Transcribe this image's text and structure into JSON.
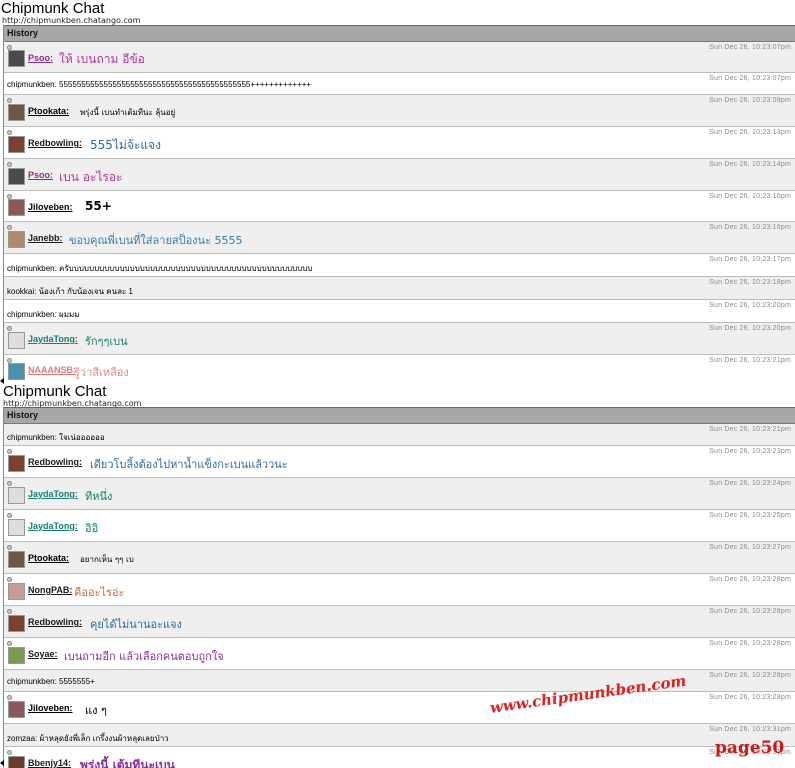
{
  "app": {
    "title": "Chipmunk Chat",
    "url": "http://chipmunkben.chatango.com"
  },
  "history_label": "History",
  "colors": {
    "Psoo": "#8a2c8a",
    "Ptookata": "#000000",
    "Redbowling": "#1a1a1a",
    "Jiloveben": "#000000",
    "Janebb": "#1a1a1a",
    "JaydaTong": "#178070",
    "NAAANSB": "#e07a7a",
    "NongPAB": "#1a1a1a",
    "Soyae": "#1a1a1a",
    "Bbenjy14": "#1a1a1a"
  },
  "top": [
    {
      "kind": "user",
      "user": "Psoo:",
      "text": "ให้ เบนถาม อีข้อ",
      "time": "Sun Dec 26, 10:23:07pm",
      "user_color": "#8a2c8a",
      "text_color": "#b03a9a",
      "size": 12,
      "avatar": "#4b4b4b"
    },
    {
      "kind": "plain",
      "text": "chipmunkben: 5555555555555555555555555555555555555555555+++++++++++++",
      "time": "Sun Dec 26, 10:23:07pm"
    },
    {
      "kind": "user",
      "user": "Ptookata:",
      "text": "พรุ่งนี้ เบนทำเต้มทีนะ  ลุ้นอยู่",
      "time": "Sun Dec 26, 10:23:09pm",
      "user_color": "#000000",
      "text_color": "#000000",
      "size": 8,
      "avatar": "#6b5a40"
    },
    {
      "kind": "user",
      "user": "Redbowling:",
      "text": "555ไม่จ้ะแจง",
      "time": "Sun Dec 26, 10:23:13pm",
      "user_color": "#1a1a1a",
      "text_color": "#2a6aa0",
      "size": 12,
      "avatar": "#7a4030"
    },
    {
      "kind": "user",
      "user": "Psoo:",
      "text": "เบน อะไรอะ",
      "time": "Sun Dec 26, 10:23:14pm",
      "user_color": "#8a2c8a",
      "text_color": "#b03a9a",
      "size": 12,
      "avatar": "#4b4b4b"
    },
    {
      "kind": "user",
      "user": "Jiloveben:",
      "text": "55+",
      "time": "Sun Dec 26, 10:23:16pm",
      "user_color": "#000000",
      "text_color": "#000000",
      "size": 12,
      "bold": true,
      "avatar": "#8a5a5a"
    },
    {
      "kind": "user",
      "user": "Janebb:",
      "text": "ขอบคุณพี่เบนที่ใส่ลายสป็องนะ 5555",
      "time": "Sun Dec 26, 10:23:16pm",
      "user_color": "#1a1a1a",
      "text_color": "#3a7aa8",
      "size": 11,
      "avatar": "#b08a70"
    },
    {
      "kind": "plain",
      "text": "chipmunkben: ครับบบบบบบบบบบบบบบบบบบบบบบบบบบบบบบบบบบบบบบบบบบบบบบบ",
      "time": "Sun Dec 26, 10:23:17pm"
    },
    {
      "kind": "plain",
      "text": "kookkai: น้องเก้า กับน้องเจน คนละ 1",
      "time": "Sun Dec 26, 10:23:18pm"
    },
    {
      "kind": "plain",
      "text": "chipmunkben: ผมมม",
      "time": "Sun Dec 26, 10:23:20pm"
    },
    {
      "kind": "user",
      "user": "JaydaTong:",
      "text": "รักๆๆเบน",
      "time": "Sun Dec 26, 10:23:20pm",
      "user_color": "#178070",
      "text_color": "#178070",
      "size": 11,
      "avatar": "#dddddd"
    },
    {
      "kind": "user",
      "user": "NAAANSB:",
      "text": "รู้ว่าสีเหลือง",
      "time": "Sun Dec 26, 10:23:21pm",
      "user_color": "#e07a7a",
      "text_color": "#e08a8a",
      "size": 11,
      "avatar": "#4a90b0"
    }
  ],
  "bottom": [
    {
      "kind": "plain",
      "text": "chipmunkben: ใจเน่ออออออ",
      "time": "Sun Dec 26, 10:23:21pm"
    },
    {
      "kind": "user",
      "user": "Redbowling:",
      "text": "เดียวโบลิ้งต้องไปหาน้ำแข็งกะเบนแล้ววนะ",
      "time": "Sun Dec 26, 10:23:23pm",
      "user_color": "#1a1a1a",
      "text_color": "#2a6aa0",
      "size": 11,
      "avatar": "#7a4030"
    },
    {
      "kind": "user",
      "user": "JaydaTong:",
      "text": "ทีหนึ่ง",
      "time": "Sun Dec 26, 10:23:24pm",
      "user_color": "#178070",
      "text_color": "#178070",
      "size": 11,
      "avatar": "#dddddd"
    },
    {
      "kind": "user",
      "user": "JaydaTong:",
      "text": "อิอิ",
      "time": "Sun Dec 26, 10:23:25pm",
      "user_color": "#178070",
      "text_color": "#178070",
      "size": 11,
      "avatar": "#dddddd"
    },
    {
      "kind": "user",
      "user": "Ptookata:",
      "text": "อยากเห็น ๆๆ เบ",
      "time": "Sun Dec 26, 10:23:27pm",
      "user_color": "#000000",
      "text_color": "#000000",
      "size": 8,
      "avatar": "#6b5a40"
    },
    {
      "kind": "user",
      "user": "NongPAB:",
      "text": "คืออะไรอ่ะ",
      "time": "Sun Dec 26, 10:23:28pm",
      "user_color": "#1a1a1a",
      "text_color": "#c0703a",
      "size": 11,
      "avatar": "#c89a9a"
    },
    {
      "kind": "user",
      "user": "Redbowling:",
      "text": "คุยได้ไม่นานอะแจง",
      "time": "Sun Dec 26, 10:23:28pm",
      "user_color": "#1a1a1a",
      "text_color": "#2a6aa0",
      "size": 11,
      "avatar": "#7a4030"
    },
    {
      "kind": "user",
      "user": "Soyae:",
      "text": "เบนถามอีก แล้วเลือกคนตอบถูกใจ",
      "time": "Sun Dec 26, 10:23:28pm",
      "user_color": "#1a1a1a",
      "text_color": "#8a2c9a",
      "size": 11,
      "avatar": "#7a9a50"
    },
    {
      "kind": "plain",
      "text": "chipmunkben: 5555555+",
      "time": "Sun Dec 26, 10:23:28pm"
    },
    {
      "kind": "user",
      "user": "Jiloveben:",
      "text": "แง ๆ",
      "time": "Sun Dec 26, 10:23:28pm",
      "user_color": "#000000",
      "text_color": "#000000",
      "size": 11,
      "avatar": "#8a5a5a"
    },
    {
      "kind": "plain",
      "text": "zomzaa: ผ้าหลุดยังพี่เล็ก เกรึ้งงนผ้าหลุดเลยป่าว",
      "time": "Sun Dec 26, 10:23:31pm"
    },
    {
      "kind": "user",
      "user": "Bbenjy14:",
      "text": "พรุ่งนี้ เต้มทีนะเบน",
      "time": "Sun Dec 26, 10:23:31pm",
      "user_color": "#1a1a1a",
      "text_color": "#8a2c9a",
      "size": 12,
      "bold": true,
      "avatar": "#6a3a2a"
    }
  ],
  "watermark": "www.chipmunkben.com",
  "page_label": "page50"
}
